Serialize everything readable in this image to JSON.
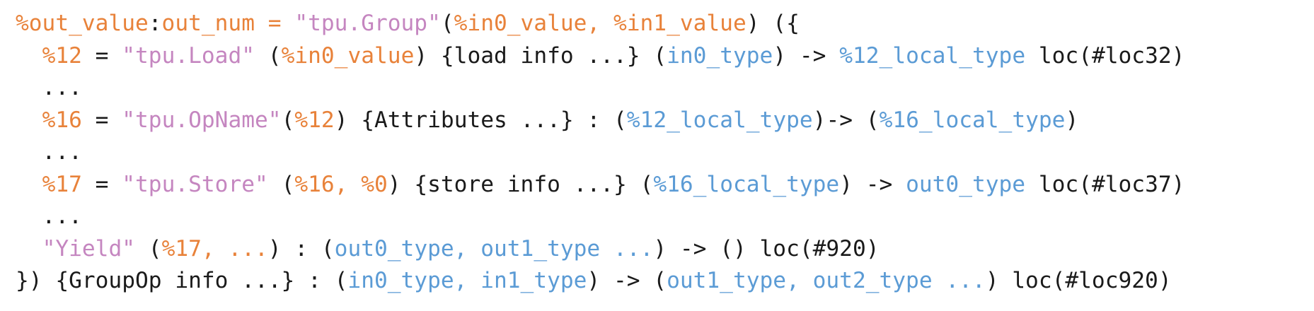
{
  "code": {
    "lines": [
      [
        {
          "t": "%out_value",
          "c": "o"
        },
        {
          "t": ":",
          "c": "k"
        },
        {
          "t": "out_num = ",
          "c": "o"
        },
        {
          "t": "\"tpu.Group\"",
          "c": "p"
        },
        {
          "t": "(",
          "c": "k"
        },
        {
          "t": "%in0_value, %in1_value",
          "c": "o"
        },
        {
          "t": ") ({",
          "c": "k"
        }
      ],
      [
        {
          "t": "  ",
          "c": "k"
        },
        {
          "t": "%12",
          "c": "o"
        },
        {
          "t": " = ",
          "c": "k"
        },
        {
          "t": "\"tpu.Load\"",
          "c": "p"
        },
        {
          "t": " (",
          "c": "k"
        },
        {
          "t": "%in0_value",
          "c": "o"
        },
        {
          "t": ") {load info ...} (",
          "c": "k"
        },
        {
          "t": "in0_type",
          "c": "b"
        },
        {
          "t": ") -> ",
          "c": "k"
        },
        {
          "t": "%12_local_type",
          "c": "b"
        },
        {
          "t": " loc(#loc32)",
          "c": "k"
        }
      ],
      [
        {
          "t": "  ...",
          "c": "k"
        }
      ],
      [
        {
          "t": "  ",
          "c": "k"
        },
        {
          "t": "%16",
          "c": "o"
        },
        {
          "t": " = ",
          "c": "k"
        },
        {
          "t": "\"tpu.OpName\"",
          "c": "p"
        },
        {
          "t": "(",
          "c": "k"
        },
        {
          "t": "%12",
          "c": "o"
        },
        {
          "t": ") {Attributes ...} : (",
          "c": "k"
        },
        {
          "t": "%12_local_type",
          "c": "b"
        },
        {
          "t": ")-> (",
          "c": "k"
        },
        {
          "t": "%16_local_type",
          "c": "b"
        },
        {
          "t": ")",
          "c": "k"
        }
      ],
      [
        {
          "t": "  ...",
          "c": "k"
        }
      ],
      [
        {
          "t": "  ",
          "c": "k"
        },
        {
          "t": "%17",
          "c": "o"
        },
        {
          "t": " = ",
          "c": "k"
        },
        {
          "t": "\"tpu.Store\"",
          "c": "p"
        },
        {
          "t": " (",
          "c": "k"
        },
        {
          "t": "%16, %0",
          "c": "o"
        },
        {
          "t": ") {store info ...} (",
          "c": "k"
        },
        {
          "t": "%16_local_type",
          "c": "b"
        },
        {
          "t": ") -> ",
          "c": "k"
        },
        {
          "t": "out0_type",
          "c": "b"
        },
        {
          "t": " loc(#loc37)",
          "c": "k"
        }
      ],
      [
        {
          "t": "  ...",
          "c": "k"
        }
      ],
      [
        {
          "t": "  ",
          "c": "k"
        },
        {
          "t": "\"Yield\"",
          "c": "p"
        },
        {
          "t": " (",
          "c": "k"
        },
        {
          "t": "%17, ...",
          "c": "o"
        },
        {
          "t": ") : (",
          "c": "k"
        },
        {
          "t": "out0_type, out1_type ...",
          "c": "b"
        },
        {
          "t": ") -> () loc(#920)",
          "c": "k"
        }
      ],
      [
        {
          "t": "}) {GroupOp info ...} : (",
          "c": "k"
        },
        {
          "t": "in0_type, in1_type",
          "c": "b"
        },
        {
          "t": ") -> (",
          "c": "k"
        },
        {
          "t": "out1_type, out2_type ...",
          "c": "b"
        },
        {
          "t": ") loc(#loc920)",
          "c": "k"
        }
      ]
    ]
  },
  "colors": {
    "text": "#1a1a1a",
    "value": "#e8823a",
    "op_name": "#c586c0",
    "type": "#5b9bd5",
    "background": "#ffffff"
  }
}
